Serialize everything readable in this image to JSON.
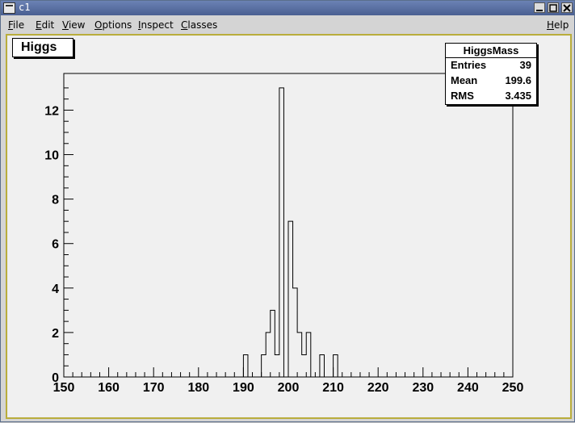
{
  "window": {
    "title": "c1"
  },
  "menubar": {
    "items": [
      {
        "label": "File",
        "u": "F",
        "rest": "ile"
      },
      {
        "label": "Edit",
        "u": "E",
        "rest": "dit"
      },
      {
        "label": "View",
        "u": "V",
        "rest": "iew"
      },
      {
        "label": "Options",
        "u": "O",
        "rest": "ptions"
      },
      {
        "label": "Inspect",
        "u": "I",
        "rest": "nspect"
      },
      {
        "label": "Classes",
        "u": "C",
        "rest": "lasses"
      }
    ],
    "help": {
      "label": "Help",
      "u": "H",
      "rest": "elp"
    }
  },
  "canvas": {
    "title_box": "Higgs",
    "stats": {
      "title": "HiggsMass",
      "rows": [
        {
          "key": "Entries",
          "value": "39"
        },
        {
          "key": "Mean",
          "value": "199.6"
        },
        {
          "key": "RMS",
          "value": "3.435"
        }
      ]
    }
  },
  "chart_data": {
    "type": "bar",
    "title": "Higgs",
    "xlabel": "",
    "ylabel": "",
    "xlim": [
      150,
      250
    ],
    "ylim": [
      0,
      13.65
    ],
    "bin_width": 1,
    "xticks": [
      150,
      160,
      170,
      180,
      190,
      200,
      210,
      220,
      230,
      240,
      250
    ],
    "yticks": [
      0,
      2,
      4,
      6,
      8,
      10,
      12
    ],
    "bins": [
      {
        "x": 190,
        "value": 1
      },
      {
        "x": 194,
        "value": 1
      },
      {
        "x": 195,
        "value": 2
      },
      {
        "x": 196,
        "value": 3
      },
      {
        "x": 197,
        "value": 1
      },
      {
        "x": 198,
        "value": 13
      },
      {
        "x": 200,
        "value": 7
      },
      {
        "x": 201,
        "value": 4
      },
      {
        "x": 202,
        "value": 2
      },
      {
        "x": 203,
        "value": 1
      },
      {
        "x": 204,
        "value": 2
      },
      {
        "x": 207,
        "value": 1
      },
      {
        "x": 210,
        "value": 1
      }
    ]
  }
}
